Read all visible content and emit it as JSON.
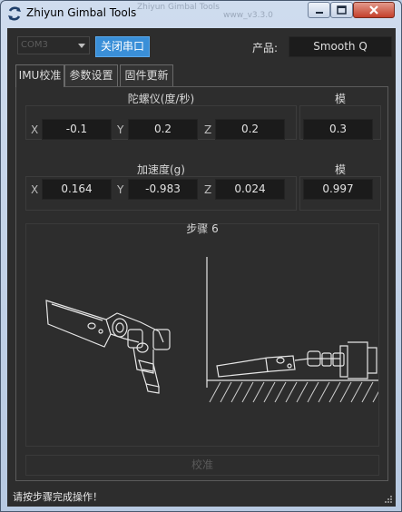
{
  "window": {
    "title": "Zhiyun Gimbal Tools",
    "faded_titles": [
      "Zhiyun Gimbal Tools",
      "www_v3.3.0"
    ]
  },
  "toolbar": {
    "port_value": "COM3",
    "close_port_label": "关闭串口",
    "product_label": "产品:",
    "product_value": "Smooth Q"
  },
  "tabs": [
    {
      "label": "IMU校准",
      "active": true
    },
    {
      "label": "参数设置",
      "active": false
    },
    {
      "label": "固件更新",
      "active": false
    }
  ],
  "gyro": {
    "title": "陀螺仪(度/秒)",
    "x_label": "X",
    "x_value": "-0.1",
    "y_label": "Y",
    "y_value": "0.2",
    "z_label": "Z",
    "z_value": "0.2",
    "mod_title": "模",
    "mod_value": "0.3"
  },
  "accel": {
    "title": "加速度(g)",
    "x_label": "X",
    "x_value": "0.164",
    "y_label": "Y",
    "y_value": "-0.983",
    "z_label": "Z",
    "z_value": "0.024",
    "mod_title": "模",
    "mod_value": "0.997"
  },
  "step": {
    "title": "步骤 6"
  },
  "calibrate_label": "校准",
  "status_text": "请按步骤完成操作！",
  "colors": {
    "client_bg": "#2d2d2d",
    "accent_button": "#3a8fd8",
    "value_field_bg": "#1b1b1b"
  }
}
